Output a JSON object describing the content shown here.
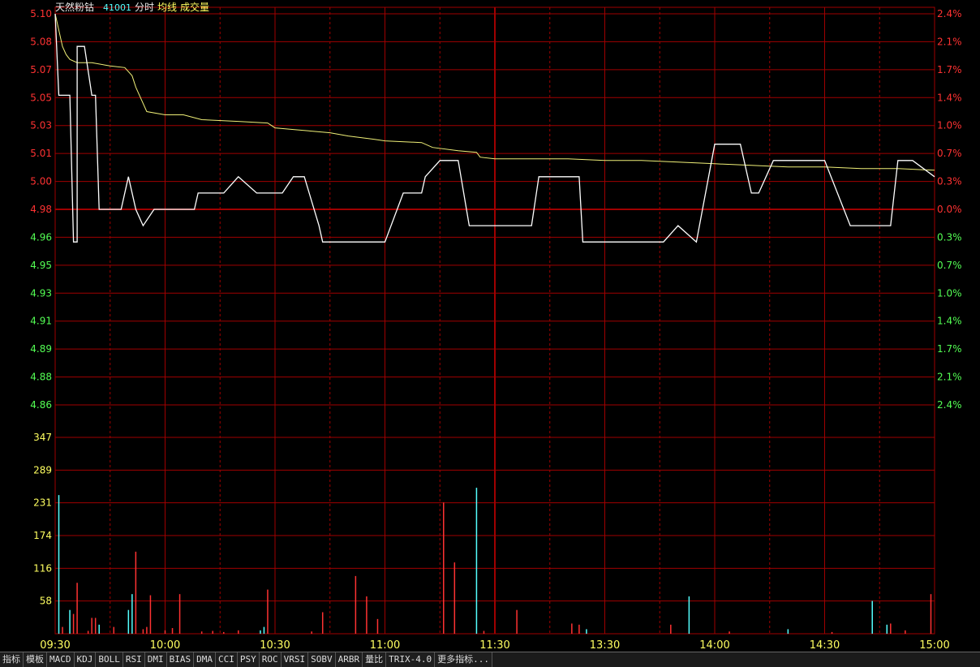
{
  "header": {
    "name": "天然粉钴",
    "code": "41001",
    "labels": [
      "分时",
      "均线",
      "成交量"
    ]
  },
  "colors": {
    "grid": "#a00000",
    "axis_red": "#ff3232",
    "axis_green": "#54ff54",
    "axis_yellow": "#ffff60",
    "price_line": "#ffffff",
    "avg_line": "#f0f078",
    "vol_up": "#ff3232",
    "vol_down": "#54ffff"
  },
  "tabs": [
    "指标",
    "模板",
    "MACD",
    "KDJ",
    "BOLL",
    "RSI",
    "DMI",
    "BIAS",
    "DMA",
    "CCI",
    "PSY",
    "ROC",
    "VRSI",
    "SOBV",
    "ARBR",
    "量比",
    "TRIX-4.0",
    "更多指标..."
  ],
  "chart_data": [
    {
      "type": "line",
      "ylim": [
        4.86,
        5.1
      ],
      "base_price": 4.98,
      "y_ticks_left": [
        "5.10",
        "5.08",
        "5.07",
        "5.05",
        "5.03",
        "5.01",
        "5.00",
        "4.98",
        "4.96",
        "4.95",
        "4.93",
        "4.91",
        "4.89",
        "4.88",
        "4.86"
      ],
      "y_ticks_right": [
        "2.4%",
        "2.1%",
        "1.7%",
        "1.4%",
        "1.0%",
        "0.7%",
        "0.3%",
        "0.0%",
        "0.3%",
        "0.7%",
        "1.0%",
        "1.4%",
        "1.7%",
        "2.1%",
        "2.4%"
      ],
      "x_ticks": [
        "09:30",
        "10:00",
        "10:30",
        "11:00",
        "11:30",
        "13:30",
        "14:00",
        "14:30",
        "15:00"
      ],
      "series": [
        {
          "x": [
            0,
            1,
            1,
            4,
            5,
            5,
            6,
            6,
            7,
            8,
            10,
            11,
            12,
            14,
            15,
            18,
            20,
            22,
            24,
            27,
            30,
            35,
            38,
            39,
            42,
            46,
            50,
            55,
            62,
            65,
            66,
            68,
            72,
            73,
            80,
            85,
            90,
            95,
            100,
            101,
            105,
            110,
            113,
            114,
            116,
            120,
            130,
            132,
            135,
            140,
            142,
            143,
            144,
            150,
            160,
            163,
            166,
            170,
            175,
            180,
            187,
            190,
            192,
            196,
            198,
            200,
            210,
            217,
            220,
            225,
            228,
            230,
            234,
            240
          ],
          "y": [
            5.1,
            5.05,
            5.05,
            5.05,
            4.96,
            4.96,
            4.96,
            5.08,
            5.08,
            5.08,
            5.05,
            5.05,
            4.98,
            4.98,
            4.98,
            4.98,
            5.0,
            4.98,
            4.97,
            4.98,
            4.98,
            4.98,
            4.98,
            4.99,
            4.99,
            4.99,
            5.0,
            4.99,
            4.99,
            5.0,
            5.0,
            5.0,
            4.97,
            4.96,
            4.96,
            4.96,
            4.96,
            4.99,
            4.99,
            5.0,
            5.01,
            5.01,
            4.97,
            4.97,
            4.97,
            4.97,
            4.97,
            5.0,
            5.0,
            5.0,
            5.0,
            5.0,
            4.96,
            4.96,
            4.96,
            4.96,
            4.96,
            4.97,
            4.96,
            5.02,
            5.02,
            4.99,
            4.99,
            5.01,
            5.01,
            5.01,
            5.01,
            4.97,
            4.97,
            4.97,
            4.97,
            5.01,
            5.01,
            5.0
          ]
        },
        {
          "x": [
            0,
            2,
            3,
            4,
            6,
            8,
            10,
            15,
            19,
            21,
            22,
            25,
            30,
            35,
            40,
            50,
            58,
            60,
            65,
            70,
            75,
            80,
            87,
            90,
            100,
            103,
            110,
            115,
            116,
            120,
            130,
            140,
            150,
            160,
            170,
            180,
            190,
            200,
            210,
            220,
            230,
            240
          ],
          "y": [
            5.1,
            5.08,
            5.075,
            5.072,
            5.07,
            5.07,
            5.07,
            5.068,
            5.067,
            5.062,
            5.055,
            5.04,
            5.038,
            5.038,
            5.035,
            5.034,
            5.033,
            5.03,
            5.029,
            5.028,
            5.027,
            5.025,
            5.023,
            5.022,
            5.021,
            5.018,
            5.016,
            5.015,
            5.012,
            5.011,
            5.011,
            5.011,
            5.01,
            5.01,
            5.009,
            5.008,
            5.007,
            5.006,
            5.006,
            5.005,
            5.005,
            5.004
          ]
        }
      ]
    },
    {
      "type": "bar",
      "ylim": [
        0,
        347
      ],
      "y_ticks": [
        "347",
        "289",
        "231",
        "174",
        "116",
        "58"
      ],
      "bars": [
        [
          1,
          245,
          "down"
        ],
        [
          2,
          12,
          "up"
        ],
        [
          4,
          42,
          "down"
        ],
        [
          5,
          35,
          "up"
        ],
        [
          6,
          90,
          "up"
        ],
        [
          9,
          5,
          "up"
        ],
        [
          10,
          28,
          "up"
        ],
        [
          11,
          28,
          "up"
        ],
        [
          12,
          16,
          "down"
        ],
        [
          16,
          12,
          "up"
        ],
        [
          20,
          42,
          "down"
        ],
        [
          21,
          70,
          "down"
        ],
        [
          22,
          145,
          "up"
        ],
        [
          24,
          8,
          "up"
        ],
        [
          25,
          12,
          "up"
        ],
        [
          26,
          68,
          "up"
        ],
        [
          30,
          6,
          "up"
        ],
        [
          32,
          10,
          "up"
        ],
        [
          34,
          70,
          "up"
        ],
        [
          40,
          4,
          "up"
        ],
        [
          43,
          5,
          "up"
        ],
        [
          46,
          3,
          "up"
        ],
        [
          50,
          6,
          "up"
        ],
        [
          56,
          6,
          "down"
        ],
        [
          57,
          12,
          "down"
        ],
        [
          58,
          78,
          "up"
        ],
        [
          70,
          4,
          "up"
        ],
        [
          73,
          38,
          "up"
        ],
        [
          82,
          102,
          "up"
        ],
        [
          85,
          66,
          "up"
        ],
        [
          88,
          26,
          "up"
        ],
        [
          106,
          232,
          "up"
        ],
        [
          109,
          126,
          "up"
        ],
        [
          115,
          258,
          "down"
        ],
        [
          117,
          5,
          "up"
        ],
        [
          126,
          42,
          "up"
        ],
        [
          141,
          18,
          "up"
        ],
        [
          143,
          16,
          "up"
        ],
        [
          145,
          8,
          "down"
        ],
        [
          168,
          16,
          "up"
        ],
        [
          173,
          66,
          "down"
        ],
        [
          184,
          4,
          "up"
        ],
        [
          200,
          8,
          "down"
        ],
        [
          212,
          3,
          "up"
        ],
        [
          223,
          58,
          "down"
        ],
        [
          227,
          16,
          "down"
        ],
        [
          228,
          18,
          "up"
        ],
        [
          232,
          6,
          "up"
        ],
        [
          239,
          70,
          "up"
        ]
      ]
    }
  ]
}
